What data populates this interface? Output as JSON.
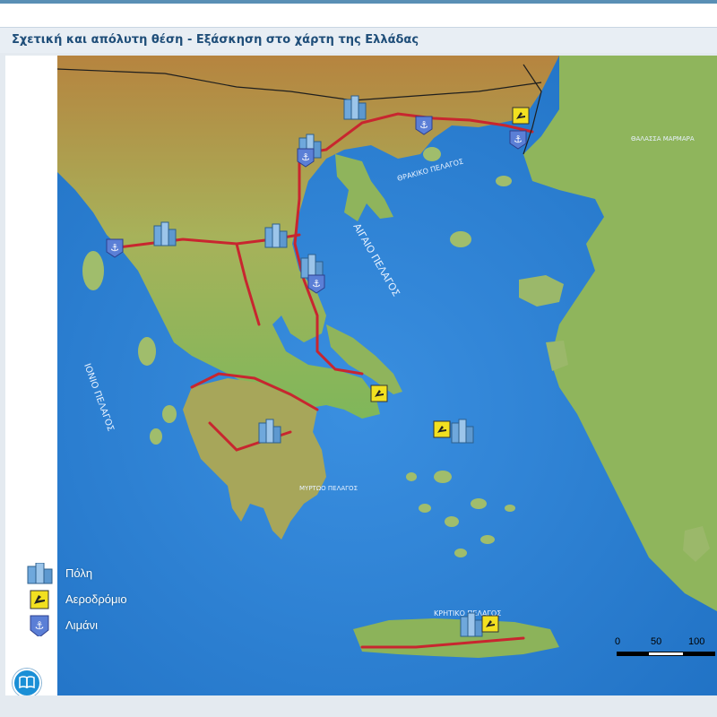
{
  "window": {
    "title": "Σχετική και απόλυτη θέση - Εξάσκηση στο χάρτη της Ελλάδας"
  },
  "legend": {
    "items": [
      {
        "label": "Πόλη",
        "icon": "city-icon"
      },
      {
        "label": "Αεροδρόμιο",
        "icon": "airport-icon"
      },
      {
        "label": "Λιμάνι",
        "icon": "port-icon"
      }
    ]
  },
  "scale": {
    "ticks": [
      "0",
      "50",
      "100"
    ]
  },
  "sea_labels": {
    "ionian": "ΙΟΝΙΟ ΠΕΛΑΓΟΣ",
    "aegean": "ΑΙΓΑΙΟ ΠΕΛΑΓΟΣ",
    "cretan": "ΚΡΗΤΙΚΟ ΠΕΛΑΓΟΣ",
    "thracian": "ΘΡΑΚΙΚΟ ΠΕΛΑΓΟΣ",
    "myrtoan": "ΜΥΡΤΩΟ ΠΕΛΑΓΟΣ",
    "marmara": "ΘΑΛΑΣΣΑ ΜΑΡΜΑΡΑ"
  },
  "toolbar": {
    "book_icon": "book-icon"
  },
  "colors": {
    "title": "#1f4e79",
    "sea": "#2a7fd0",
    "land_low": "#7fb75a",
    "land_high": "#c98b4a",
    "roads": "#c8262f",
    "button": "#1a8fd6"
  }
}
